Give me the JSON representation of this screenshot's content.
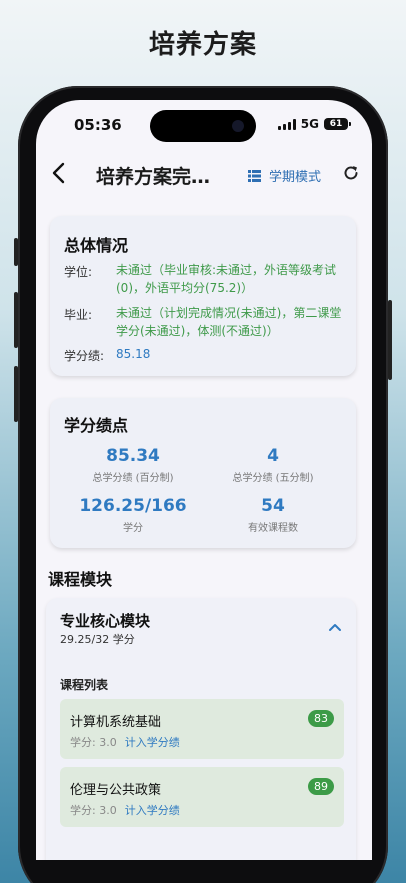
{
  "caption": "培养方案",
  "status": {
    "time": "05:36",
    "network": "5G",
    "battery": "61"
  },
  "appbar": {
    "title": "培养方案完成情况",
    "mode_label": "学期模式"
  },
  "overview": {
    "title": "总体情况",
    "degree_label": "学位:",
    "degree_value": "未通过（毕业审核:未通过，外语等级考试(0)，外语平均分(75.2)）",
    "grad_label": "毕业:",
    "grad_value": "未通过（计划完成情况(未通过)，第二课堂学分(未通过)，体测(不通过)）",
    "gpa_label": "学分绩:",
    "gpa_value": "85.18"
  },
  "credits": {
    "title": "学分绩点",
    "stats": [
      {
        "num": "85.34",
        "label": "总学分绩 (百分制)"
      },
      {
        "num": "4",
        "label": "总学分绩 (五分制)"
      },
      {
        "num": "126.25/166",
        "label": "学分"
      },
      {
        "num": "54",
        "label": "有效课程数"
      }
    ]
  },
  "modules_section": "课程模块",
  "module": {
    "title": "专业核心模块",
    "subtitle": "29.25/32 学分",
    "list_title": "课程列表",
    "courses": [
      {
        "name": "计算机系统基础",
        "credit": "学分: 3.0",
        "include": "计入学分绩",
        "score": "83"
      },
      {
        "name": "伦理与公共政策",
        "credit": "学分: 3.0",
        "include": "计入学分绩",
        "score": "89"
      }
    ]
  },
  "colors": {
    "accent": "#2f7ac1",
    "pass_green": "#3f9a4a",
    "score_badge": "#3c9b47"
  }
}
